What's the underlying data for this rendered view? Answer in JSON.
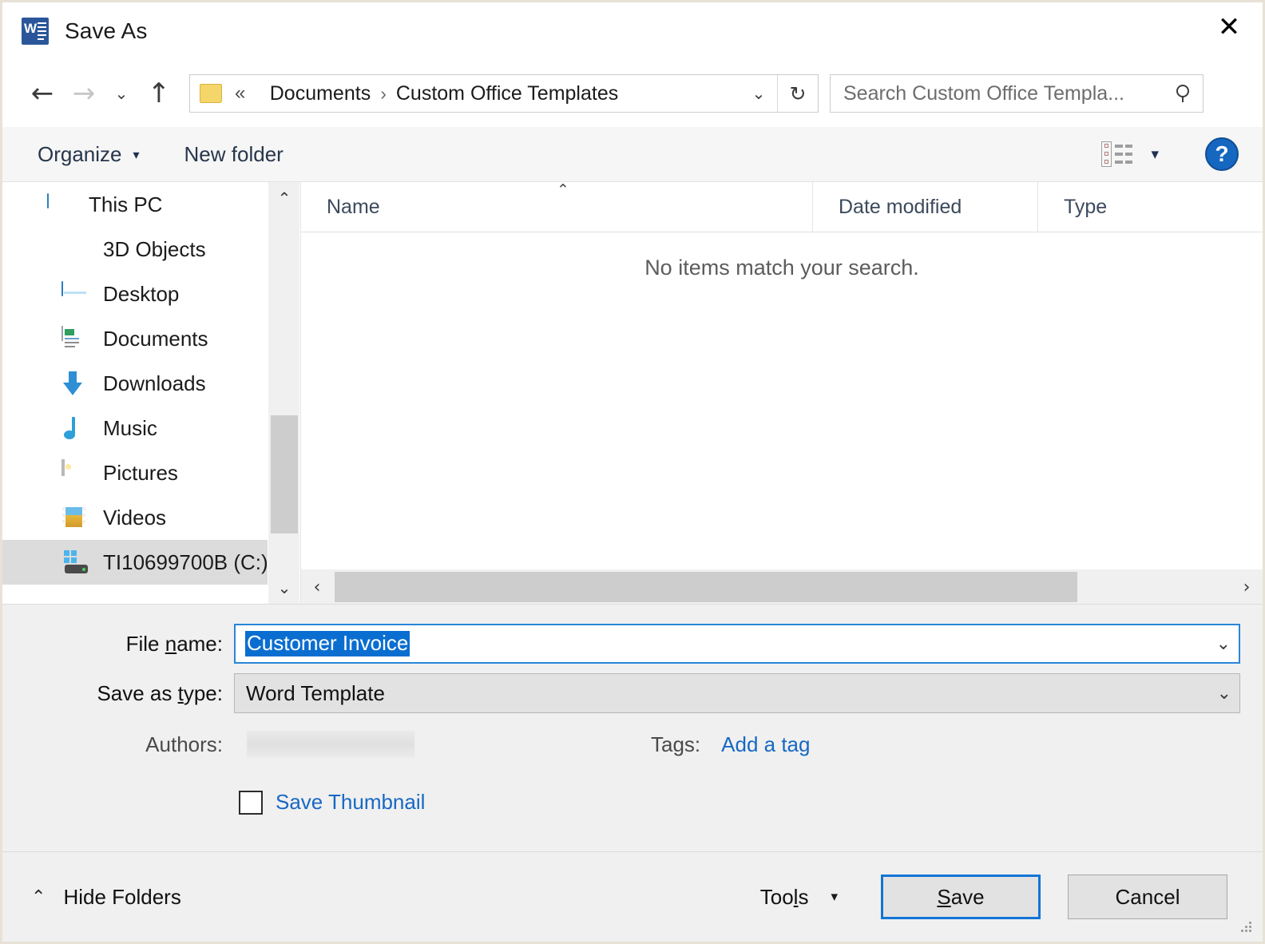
{
  "window": {
    "title": "Save As",
    "app_icon": "word-icon",
    "close_label": "✕"
  },
  "navigation": {
    "back_icon": "←",
    "forward_icon": "→",
    "recent_icon": "⌄",
    "up_icon": "↑",
    "address": {
      "folder_icon": "folder-icon",
      "overflow": "«",
      "separator": "›",
      "crumbs": [
        "Documents",
        "Custom Office Templates"
      ],
      "dropdown_icon": "⌄",
      "refresh_icon": "↻"
    },
    "search": {
      "placeholder": "Search Custom Office Templa...",
      "icon": "search-icon"
    }
  },
  "command_bar": {
    "organize_label": "Organize",
    "organize_caret": "▾",
    "new_folder_label": "New folder",
    "view_icon": "list-view-icon",
    "view_caret": "▾",
    "help_label": "?"
  },
  "sidebar": {
    "items": [
      {
        "label": "This PC",
        "icon": "this-pc-icon",
        "level": "root",
        "selected": false
      },
      {
        "label": "3D Objects",
        "icon": "3d-objects-icon",
        "level": "child",
        "selected": false
      },
      {
        "label": "Desktop",
        "icon": "desktop-icon",
        "level": "child",
        "selected": false
      },
      {
        "label": "Documents",
        "icon": "documents-icon",
        "level": "child",
        "selected": false
      },
      {
        "label": "Downloads",
        "icon": "downloads-icon",
        "level": "child",
        "selected": false
      },
      {
        "label": "Music",
        "icon": "music-icon",
        "level": "child",
        "selected": false
      },
      {
        "label": "Pictures",
        "icon": "pictures-icon",
        "level": "child",
        "selected": false
      },
      {
        "label": "Videos",
        "icon": "videos-icon",
        "level": "child",
        "selected": false
      },
      {
        "label": "TI10699700B (C:)",
        "icon": "local-disk-icon",
        "level": "child",
        "selected": true
      }
    ],
    "scroll_up_icon": "⌃",
    "scroll_down_icon": "⌄"
  },
  "file_list": {
    "columns": [
      {
        "label": "Name",
        "sorted": true,
        "sort_icon": "⌃"
      },
      {
        "label": "Date modified",
        "sorted": false
      },
      {
        "label": "Type",
        "sorted": false
      }
    ],
    "rows": [],
    "empty_message": "No items match your search.",
    "h_scroll_left_icon": "‹",
    "h_scroll_right_icon": "›"
  },
  "form": {
    "file_name": {
      "label_before": "File ",
      "label_accel": "n",
      "label_after": "ame:",
      "value": "Customer Invoice",
      "selected": true,
      "dropdown_icon": "⌄"
    },
    "save_as_type": {
      "label_before": "Save as ",
      "label_accel": "t",
      "label_after": "ype:",
      "value": "Word Template",
      "dropdown_icon": "⌄"
    },
    "authors": {
      "label": "Authors:",
      "value": ""
    },
    "tags": {
      "label": "Tags:",
      "link_label": "Add a tag"
    },
    "save_thumbnail": {
      "label": "Save Thumbnail",
      "checked": false
    }
  },
  "footer": {
    "hide_folders_caret": "⌃",
    "hide_folders_label": "Hide Folders",
    "tools_before": "Too",
    "tools_accel": "l",
    "tools_after": "s",
    "tools_caret": "▾",
    "save_before": "",
    "save_accel": "S",
    "save_after": "ave",
    "cancel_label": "Cancel"
  },
  "colors": {
    "accent_blue": "#1275d6",
    "selection_blue": "#0a6ed1",
    "link_blue": "#1768c4",
    "form_background": "#f0f0f0",
    "window_border": "#e8e2d6"
  }
}
